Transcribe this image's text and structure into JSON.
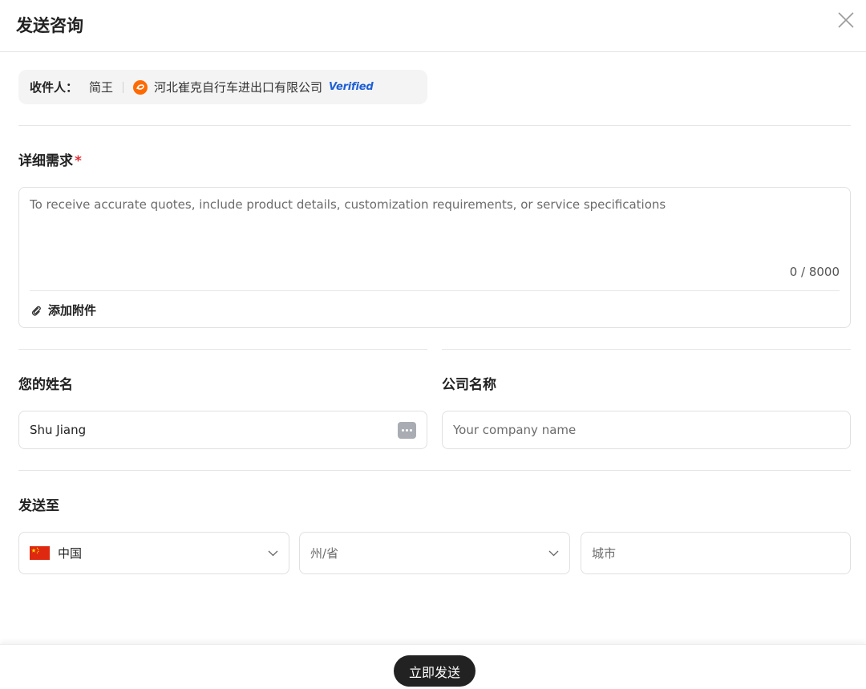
{
  "dialog": {
    "title": "发送咨询"
  },
  "recipient": {
    "label": "收件人：",
    "name": "简王",
    "company": "河北崔克自行车进出口有限公司",
    "verified": "Verified"
  },
  "requirements": {
    "label": "详细需求",
    "required_mark": "*",
    "placeholder": "To receive accurate quotes, include product details, customization requirements, or service specifications",
    "value": "",
    "char_count": "0 / 8000",
    "attach_label": "添加附件"
  },
  "name_field": {
    "label": "您的姓名",
    "value": "Shu Jiang"
  },
  "company_field": {
    "label": "公司名称",
    "placeholder": "Your company name",
    "value": ""
  },
  "send_to": {
    "label": "发送至",
    "country": "中国",
    "state_placeholder": "州/省",
    "city_placeholder": "城市"
  },
  "footer": {
    "send_label": "立即发送"
  },
  "icons": {
    "close": "close-icon",
    "company_logo": "supplier-logo-icon",
    "attach": "paperclip-icon",
    "autofill": "more-dots-icon",
    "chevron": "chevron-down-icon",
    "flag": "china-flag-icon"
  },
  "colors": {
    "accent_dark": "#222222",
    "required": "#e0313a",
    "verified": "#1f5fd6",
    "logo": "#ff6a00"
  }
}
